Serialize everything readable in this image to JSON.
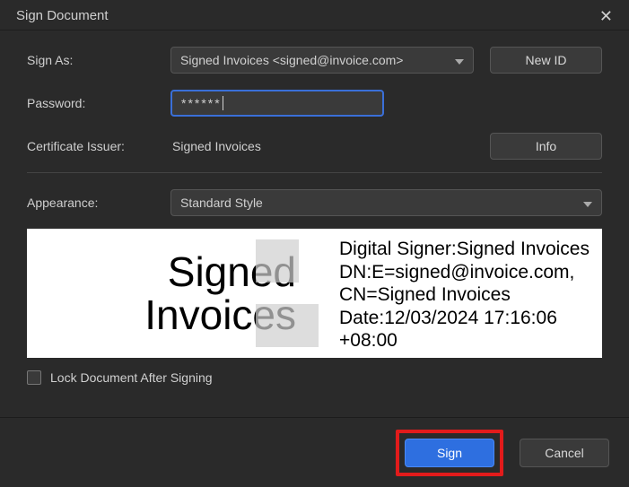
{
  "window": {
    "title": "Sign Document"
  },
  "labels": {
    "sign_as": "Sign As:",
    "password": "Password:",
    "issuer": "Certificate Issuer:",
    "appearance": "Appearance:",
    "lock": "Lock Document After Signing"
  },
  "sign_as": {
    "selected": "Signed Invoices <signed@invoice.com>"
  },
  "buttons": {
    "new_id": "New ID",
    "info": "Info",
    "sign": "Sign",
    "cancel": "Cancel"
  },
  "password": {
    "value": "******"
  },
  "issuer": {
    "value": "Signed Invoices"
  },
  "appearance": {
    "selected": "Standard Style"
  },
  "preview": {
    "name_line1": "Signed",
    "name_line2": "Invoices",
    "line1": "Digital Signer:Signed Invoices",
    "line2": "DN:E=signed@invoice.com,",
    "line3": "CN=Signed Invoices",
    "line4": "Date:12/03/2024 17:16:06",
    "line5": "+08:00"
  },
  "lock": {
    "checked": false
  }
}
